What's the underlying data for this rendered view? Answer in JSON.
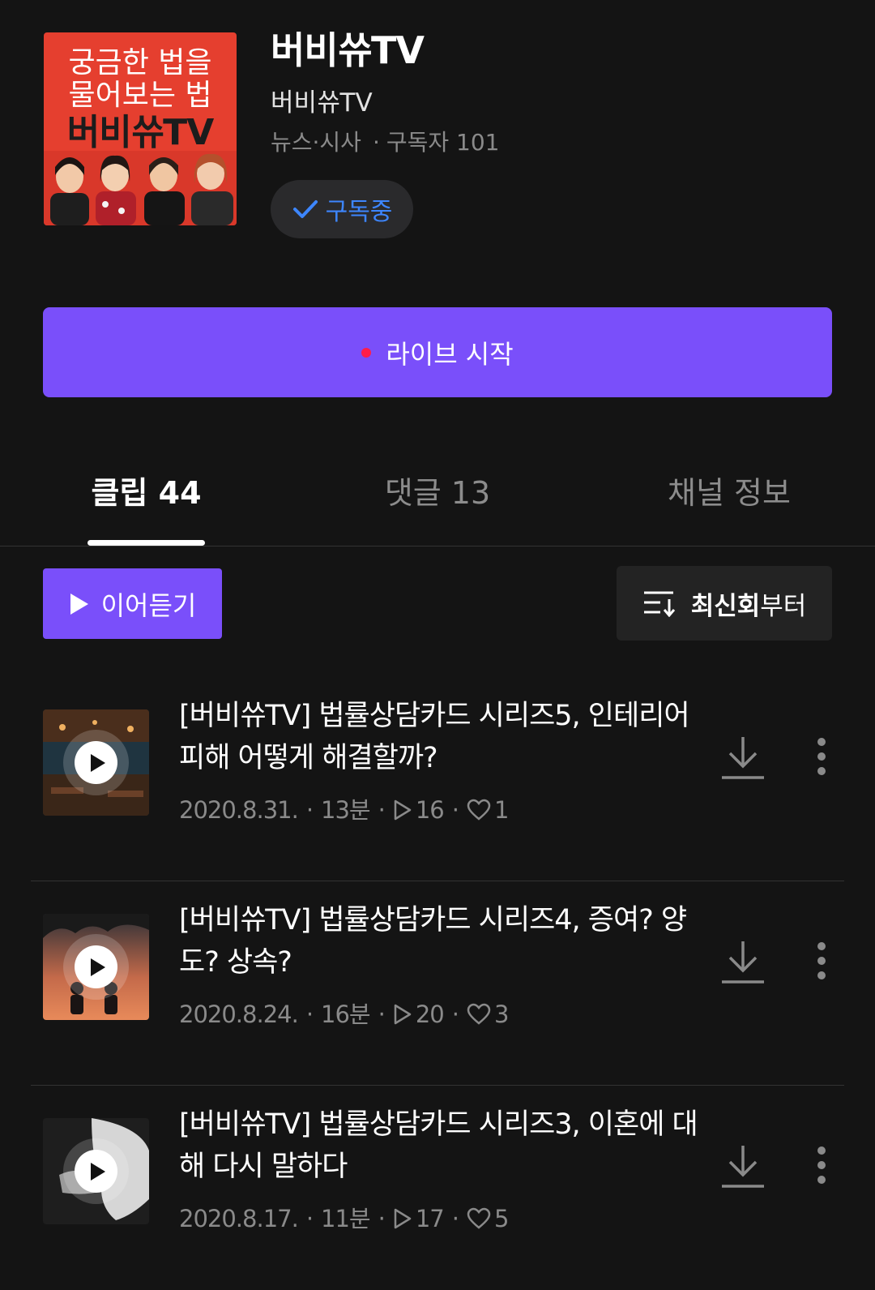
{
  "channel": {
    "cover_lines": [
      "궁금한 법을",
      "물어보는 법",
      "버비쓔TV"
    ],
    "title": "버비쓔TV",
    "author": "버비쓔TV",
    "category": "뉴스·시사",
    "subscribers": "구독자 101",
    "subscribe_label": "구독중"
  },
  "live": {
    "label": "라이브 시작",
    "dot_color": "#ff1d4a"
  },
  "tabs": [
    {
      "label": "클립 44",
      "active": true
    },
    {
      "label": "댓글 13",
      "active": false
    },
    {
      "label": "채널 정보",
      "active": false
    }
  ],
  "controls": {
    "resume_label": "이어듣기",
    "sort_bold": "최신회",
    "sort_rest": "부터"
  },
  "episodes": [
    {
      "title": "[버비쓔TV] 법률상담카드 시리즈5, 인테리어 피해 어떻게 해결할까?",
      "date": "2020.8.31.",
      "duration": "13분",
      "plays": "16",
      "likes": "1",
      "thumb_icon": "night-restaurant-thumbnail"
    },
    {
      "title": "[버비쓔TV] 법률상담카드 시리즈4, 증여? 양도? 상속?",
      "date": "2020.8.24.",
      "duration": "16분",
      "plays": "20",
      "likes": "3",
      "thumb_icon": "sunset-couple-thumbnail"
    },
    {
      "title": "[버비쓔TV] 법률상담카드 시리즈3, 이혼에 대해 다시 말하다",
      "date": "2020.8.17.",
      "duration": "11분",
      "plays": "17",
      "likes": "5",
      "thumb_icon": "hands-thumbnail"
    }
  ],
  "colors": {
    "background": "#141414",
    "accent": "#7a4ffa",
    "subscribe_text": "#3d86ff",
    "cover_red": "#e53f2f",
    "muted": "#8a8a8a"
  }
}
